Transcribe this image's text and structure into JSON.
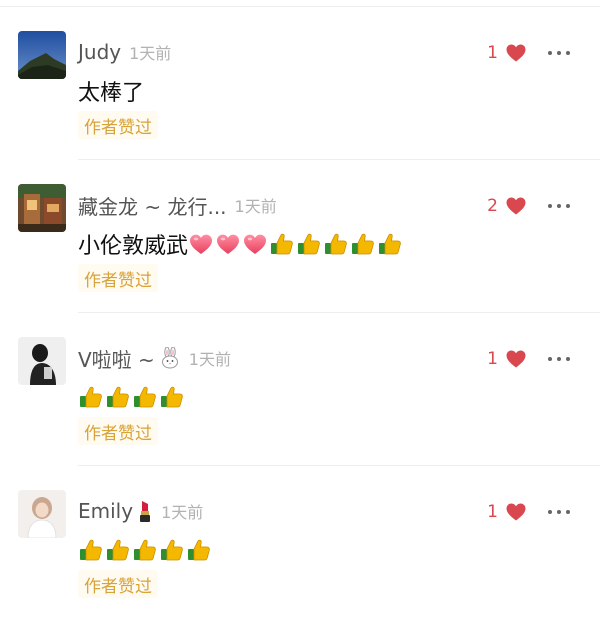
{
  "comments": [
    {
      "name": "Judy",
      "time": "1天前",
      "likes": "1",
      "text": "太棒了",
      "author_liked": "作者赞过",
      "emojis": [],
      "hearts": 0
    },
    {
      "name": "藏金龙 ~ 龙行...",
      "time": "1天前",
      "likes": "2",
      "text": "小伦敦威武",
      "author_liked": "作者赞过",
      "emojis": [
        "heart",
        "heart",
        "heart",
        "thumbs-up",
        "thumbs-up",
        "thumbs-up",
        "thumbs-up",
        "thumbs-up"
      ]
    },
    {
      "name": "V啦啦 ~",
      "name_icon": "rabbit-icon",
      "time": "1天前",
      "likes": "1",
      "text": "",
      "author_liked": "作者赞过",
      "emojis": [
        "thumbs-up",
        "thumbs-up",
        "thumbs-up",
        "thumbs-up"
      ]
    },
    {
      "name": "Emily",
      "name_icon": "lipstick-icon",
      "time": "1天前",
      "likes": "1",
      "text": "",
      "author_liked": "作者赞过",
      "emojis": [
        "thumbs-up",
        "thumbs-up",
        "thumbs-up",
        "thumbs-up",
        "thumbs-up"
      ]
    }
  ],
  "colors": {
    "like_red": "#d9474f",
    "author_like_gold": "#d7a33a",
    "name_gray": "#555555",
    "time_gray": "#b2b2b2"
  }
}
